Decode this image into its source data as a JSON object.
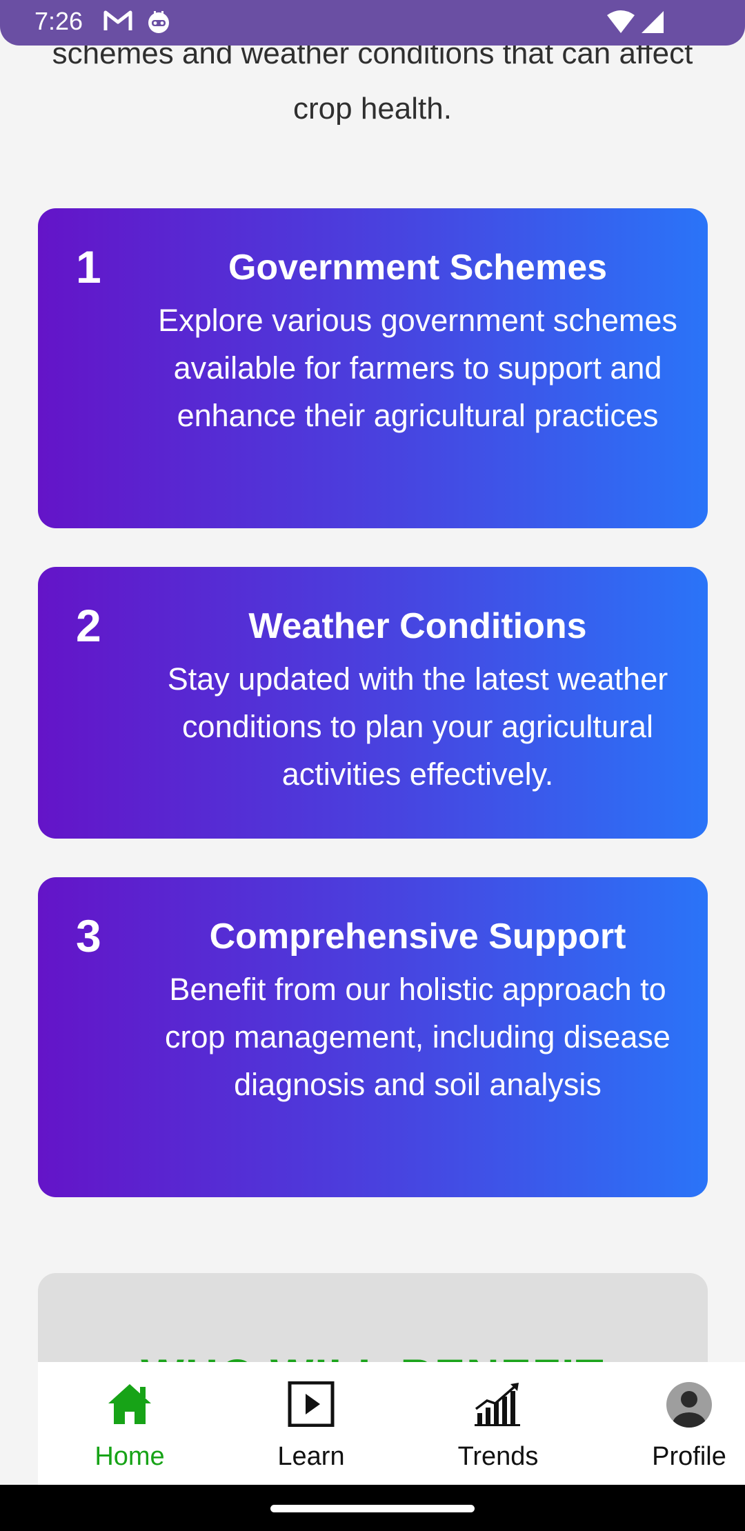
{
  "status_bar": {
    "time": "7:26",
    "icons": [
      "gmail-icon",
      "robot-icon",
      "wifi-icon",
      "signal-icon"
    ],
    "background": "#6a4fa3"
  },
  "intro": {
    "text": "schemes and weather conditions that can affect crop health."
  },
  "cards": [
    {
      "number": "1",
      "title": "Government Schemes",
      "description": "Explore various government schemes available for farmers to support and enhance their agricultural practices"
    },
    {
      "number": "2",
      "title": "Weather Conditions",
      "description": "Stay updated with the latest weather conditions to plan your agricultural activities effectively."
    },
    {
      "number": "3",
      "title": "Comprehensive Support",
      "description": "Benefit from our holistic approach to crop management, including disease diagnosis and soil analysis"
    }
  ],
  "card_gradient": [
    "#6414c8",
    "#4a40de",
    "#2a74f8"
  ],
  "benefit": {
    "heading": "WHO WILL BENEFIT"
  },
  "bottom_nav": {
    "items": [
      {
        "label": "Home",
        "icon": "home-icon",
        "active": true
      },
      {
        "label": "Learn",
        "icon": "play-icon",
        "active": false
      },
      {
        "label": "Trends",
        "icon": "trends-chart-icon",
        "active": false
      },
      {
        "label": "Profile",
        "icon": "profile-avatar-icon",
        "active": false
      }
    ],
    "active_color": "#17a317"
  }
}
